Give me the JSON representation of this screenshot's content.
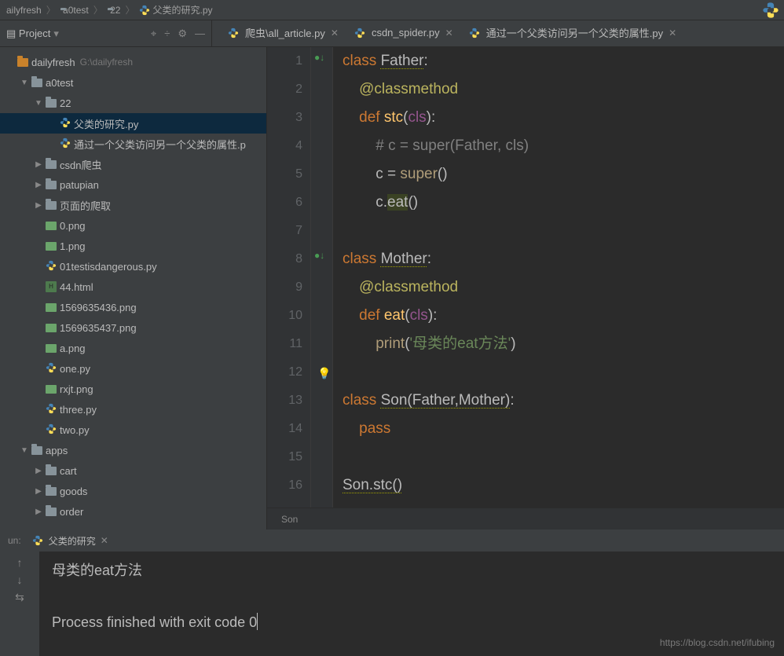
{
  "breadcrumb": {
    "parts": [
      "ailyfresh",
      "a0test",
      "22",
      "父类的研究.py"
    ]
  },
  "project_panel": {
    "title": "Project"
  },
  "tabs": [
    {
      "label": "爬虫\\all_article.py",
      "active": false
    },
    {
      "label": "csdn_spider.py",
      "active": false
    },
    {
      "label": "通过一个父类访问另一个父类的属性.py",
      "active": false
    }
  ],
  "tree": [
    {
      "indent": 0,
      "chev": "",
      "kind": "root",
      "label": "dailyfresh",
      "path": "G:\\dailyfresh"
    },
    {
      "indent": 1,
      "chev": "▼",
      "kind": "folder",
      "label": "a0test"
    },
    {
      "indent": 2,
      "chev": "▼",
      "kind": "folder",
      "label": "22"
    },
    {
      "indent": 3,
      "chev": "",
      "kind": "py",
      "label": "父类的研究.py",
      "selected": true
    },
    {
      "indent": 3,
      "chev": "",
      "kind": "py",
      "label": "通过一个父类访问另一个父类的属性.p"
    },
    {
      "indent": 2,
      "chev": "▶",
      "kind": "folder",
      "label": "csdn爬虫"
    },
    {
      "indent": 2,
      "chev": "▶",
      "kind": "folder",
      "label": "patupian"
    },
    {
      "indent": 2,
      "chev": "▶",
      "kind": "folder",
      "label": "页面的爬取"
    },
    {
      "indent": 2,
      "chev": "",
      "kind": "img",
      "label": "0.png"
    },
    {
      "indent": 2,
      "chev": "",
      "kind": "img",
      "label": "1.png"
    },
    {
      "indent": 2,
      "chev": "",
      "kind": "py",
      "label": "01testisdangerous.py"
    },
    {
      "indent": 2,
      "chev": "",
      "kind": "html",
      "label": "44.html"
    },
    {
      "indent": 2,
      "chev": "",
      "kind": "img",
      "label": "1569635436.png"
    },
    {
      "indent": 2,
      "chev": "",
      "kind": "img",
      "label": "1569635437.png"
    },
    {
      "indent": 2,
      "chev": "",
      "kind": "img",
      "label": "a.png"
    },
    {
      "indent": 2,
      "chev": "",
      "kind": "py",
      "label": "one.py"
    },
    {
      "indent": 2,
      "chev": "",
      "kind": "img",
      "label": "rxjt.png"
    },
    {
      "indent": 2,
      "chev": "",
      "kind": "py",
      "label": "three.py"
    },
    {
      "indent": 2,
      "chev": "",
      "kind": "py",
      "label": "two.py"
    },
    {
      "indent": 1,
      "chev": "▼",
      "kind": "folder",
      "label": "apps"
    },
    {
      "indent": 2,
      "chev": "▶",
      "kind": "folder",
      "label": "cart"
    },
    {
      "indent": 2,
      "chev": "▶",
      "kind": "folder",
      "label": "goods"
    },
    {
      "indent": 2,
      "chev": "▶",
      "kind": "folder",
      "label": "order"
    }
  ],
  "code": {
    "lines": [
      {
        "n": 1,
        "html": "<span class='kw'>class </span><span class='class-warn'>Father</span>:"
      },
      {
        "n": 2,
        "html": "    <span class='dec'>@classmethod</span>"
      },
      {
        "n": 3,
        "html": "    <span class='kw'>def </span><span class='fn'>stc</span>(<span class='self'>cls</span>):"
      },
      {
        "n": 4,
        "html": "        <span class='cm'># c = super(Father, cls)</span>"
      },
      {
        "n": 5,
        "html": "        c = <span class='call'>super</span>()"
      },
      {
        "n": 6,
        "html": "        c.<span class='highlight-eat'>eat</span>()"
      },
      {
        "n": 7,
        "html": ""
      },
      {
        "n": 8,
        "html": "<span class='kw'>class </span><span class='class-warn'>Mother</span>:"
      },
      {
        "n": 9,
        "html": "    <span class='dec'>@classmethod</span>"
      },
      {
        "n": 10,
        "html": "    <span class='kw'>def </span><span class='fn'>eat</span>(<span class='self'>cls</span>):"
      },
      {
        "n": 11,
        "html": "        <span class='call'>print</span>(<span class='str'>'母类的eat方法'</span>)"
      },
      {
        "n": 12,
        "html": ""
      },
      {
        "n": 13,
        "html": "<span class='kw'>class </span><span class='class-warn'>Son(Father,Mother)</span>:"
      },
      {
        "n": 14,
        "html": "    <span class='kw'>pass</span>"
      },
      {
        "n": 15,
        "html": ""
      },
      {
        "n": 16,
        "html": "<span class='class-warn'>Son.stc()</span>"
      }
    ],
    "breadcrumb": "Son"
  },
  "run": {
    "panel_label": "un:",
    "tab_label": "父类的研究",
    "output": "母类的eat方法\n\nProcess finished with exit code 0"
  },
  "watermark": "https://blog.csdn.net/ifubing"
}
